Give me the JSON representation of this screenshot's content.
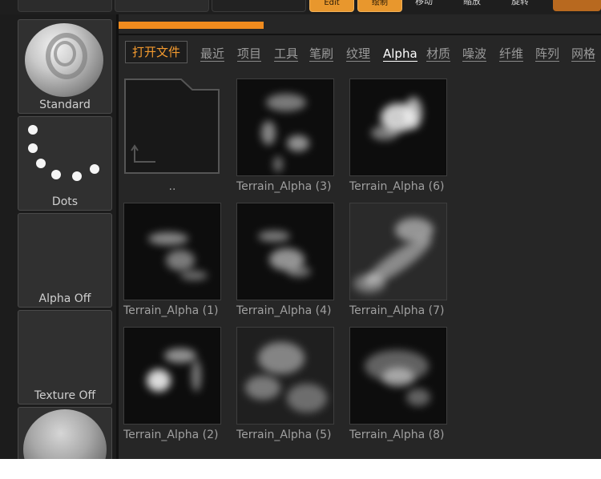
{
  "topbar": {
    "accent_left": "Edit",
    "accent_right": "绘制",
    "items": [
      "移动",
      "缩放",
      "旋转"
    ]
  },
  "brushes": [
    {
      "label": "Standard"
    },
    {
      "label": "Dots"
    },
    {
      "label": "Alpha Off"
    },
    {
      "label": "Texture Off"
    }
  ],
  "progress": {
    "value": 0.3
  },
  "tabs": [
    {
      "label": "打开文件"
    },
    {
      "label": "最近"
    },
    {
      "label": "项目"
    },
    {
      "label": "工具"
    },
    {
      "label": "笔刷"
    },
    {
      "label": "纹理"
    },
    {
      "label": "Alpha"
    },
    {
      "label": "材质"
    },
    {
      "label": "噪波"
    },
    {
      "label": "纤维"
    },
    {
      "label": "阵列"
    },
    {
      "label": "网格"
    }
  ],
  "active_tab": "Alpha",
  "files": [
    {
      "label": ".."
    },
    {
      "label": "Terrain_Alpha (3)"
    },
    {
      "label": "Terrain_Alpha (6)"
    },
    {
      "label": "Terrain_Alpha (1)"
    },
    {
      "label": "Terrain_Alpha (4)"
    },
    {
      "label": "Terrain_Alpha (7)"
    },
    {
      "label": "Terrain_Alpha (2)"
    },
    {
      "label": "Terrain_Alpha (5)"
    },
    {
      "label": "Terrain_Alpha (8)"
    }
  ],
  "colors": {
    "accent": "#f08b1e",
    "panel": "#262626",
    "tab_open": "#f39a2f"
  }
}
